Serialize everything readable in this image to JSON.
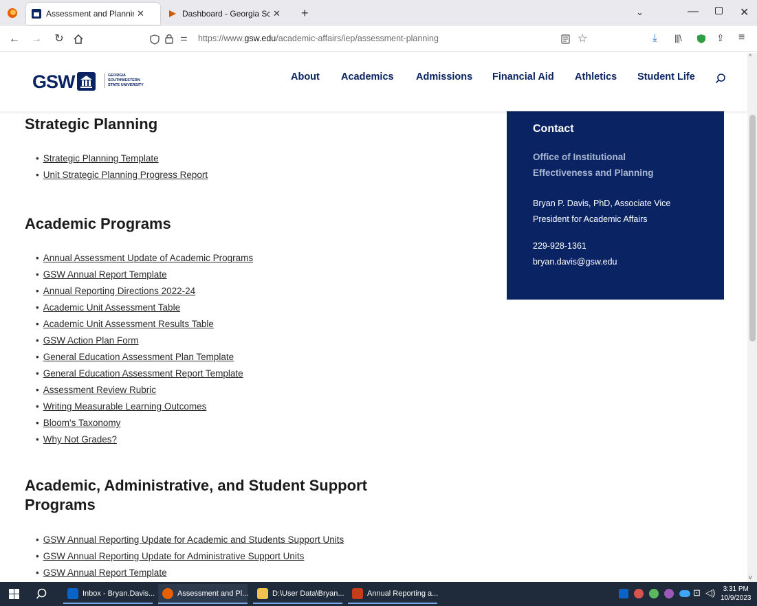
{
  "browser": {
    "tabs": [
      {
        "label": "Assessment and Planning Reso",
        "active": true
      },
      {
        "label": "Dashboard - Georgia Southwest",
        "active": false
      }
    ],
    "new_tab": "+",
    "url_prefix": "https://www.",
    "url_domain": "gsw.edu",
    "url_path": "/academic-affairs/iep/assessment-planning"
  },
  "site": {
    "logo_text": "GSW",
    "logo_sub": [
      "GEORGIA",
      "SOUTHWESTERN",
      "STATE UNIVERSITY"
    ],
    "nav": [
      "About",
      "Academics",
      "Admissions",
      "Financial Aid",
      "Athletics",
      "Student Life"
    ]
  },
  "sections": [
    {
      "title": "Strategic Planning",
      "links": [
        "Strategic Planning Template",
        "Unit Strategic Planning Progress Report"
      ]
    },
    {
      "title": "Academic Programs",
      "links": [
        "Annual Assessment Update of Academic Programs",
        "GSW Annual Report Template",
        "Annual Reporting Directions 2022-24",
        "Academic Unit Assessment Table",
        "Academic Unit Assessment Results Table",
        "GSW Action Plan Form",
        "General Education Assessment Plan Template",
        "General Education Assessment Report Template",
        "Assessment Review Rubric",
        "Writing Measurable Learning Outcomes",
        "Bloom's Taxonomy",
        "Why Not Grades?"
      ]
    },
    {
      "title_line1": "Academic, Administrative, and Student Support",
      "title_line2": "Programs",
      "links": [
        "GSW Annual Reporting Update for Academic and Students Support Units",
        "GSW Annual Reporting Update for Administrative Support Units",
        "GSW Annual Report Template"
      ]
    }
  ],
  "contact": {
    "title": "Contact",
    "office_line1": "Office of Institutional",
    "office_line2": "Effectiveness and Planning",
    "person_line1": "Bryan P. Davis, PhD, Associate Vice",
    "person_line2": "President for Academic Affairs",
    "phone": "229-928-1361",
    "email": "bryan.davis@gsw.edu"
  },
  "taskbar": {
    "items": [
      {
        "label": "Inbox - Bryan.Davis...",
        "color": "#0a64c8"
      },
      {
        "label": "Assessment and Pl...",
        "color": "#e66000"
      },
      {
        "label": "D:\\User Data\\Bryan...",
        "color": "#f2c14e"
      },
      {
        "label": "Annual Reporting a...",
        "color": "#c43e1c"
      }
    ],
    "time": "3:31 PM",
    "date": "10/9/2023"
  }
}
